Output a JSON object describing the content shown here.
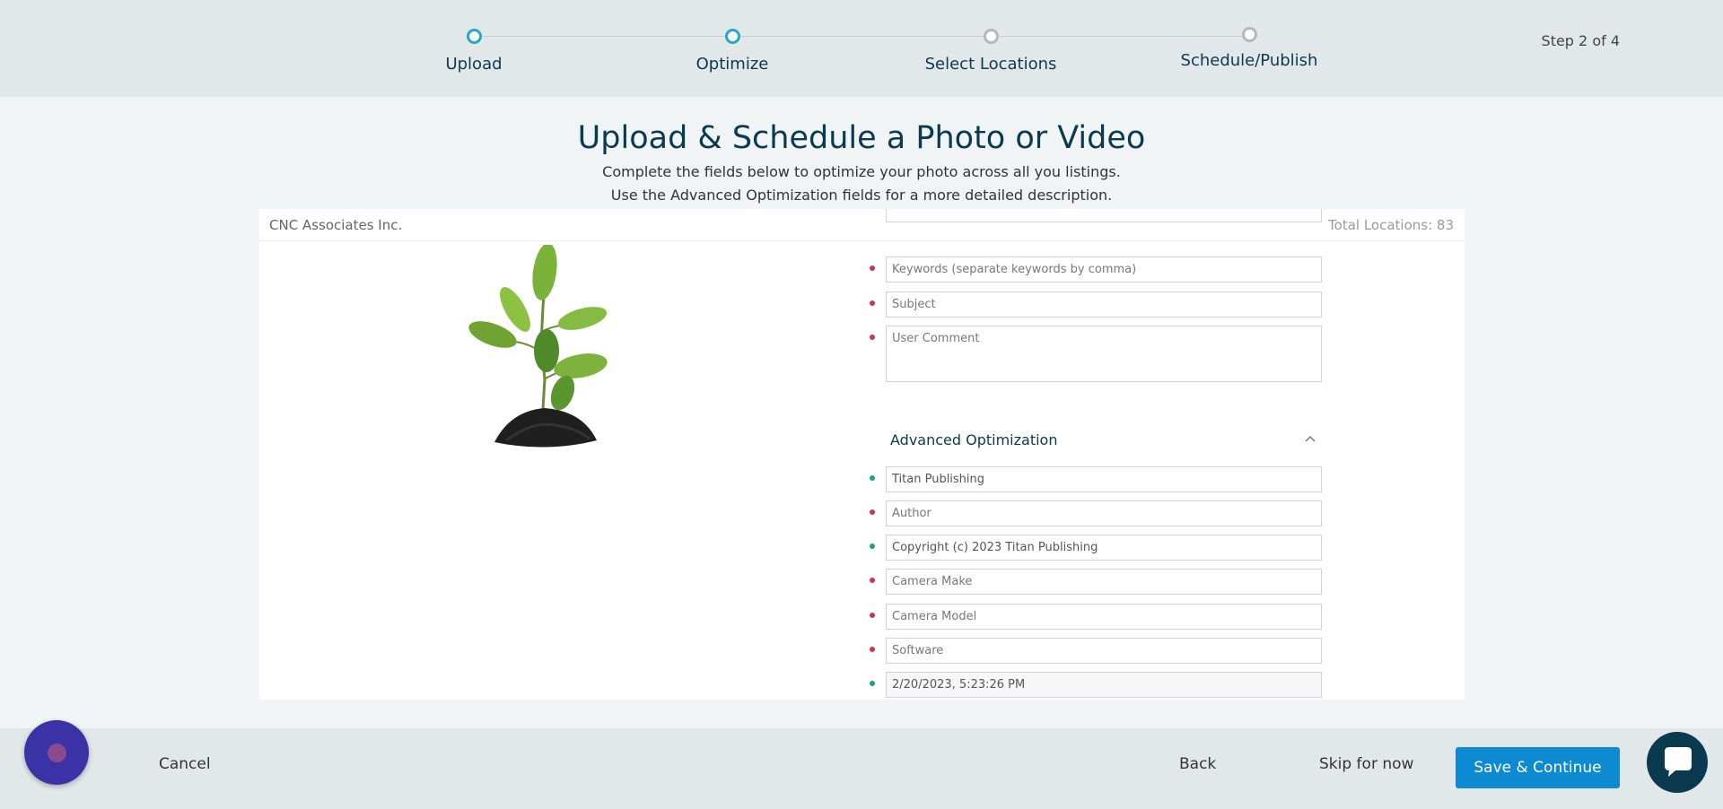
{
  "stepper": {
    "steps": [
      {
        "label": "Upload",
        "state": "done"
      },
      {
        "label": "Optimize",
        "state": "current"
      },
      {
        "label": "Select Locations",
        "state": "pending"
      },
      {
        "label": "Schedule/Publish",
        "state": "pending"
      }
    ],
    "step_count": "Step 2 of 4"
  },
  "page": {
    "title": "Upload & Schedule a Photo or Video",
    "subtitle_line1": "Complete the fields below to optimize your photo across all you listings.",
    "subtitle_line2": "Use the Advanced Optimization fields for a more detailed description."
  },
  "card": {
    "org_name": "CNC Associates Inc.",
    "total_locations": "Total Locations: 83"
  },
  "fields": {
    "keywords_placeholder": "Keywords (separate keywords by comma)",
    "subject_placeholder": "Subject",
    "user_comment_placeholder": "User Comment"
  },
  "advanced": {
    "title": "Advanced Optimization",
    "publisher_value": "Titan Publishing",
    "author_placeholder": "Author",
    "copyright_value": "Copyright (c) 2023 Titan Publishing",
    "camera_make_placeholder": "Camera Make",
    "camera_model_placeholder": "Camera Model",
    "software_placeholder": "Software",
    "datetime_value": "2/20/2023, 5:23:26 PM"
  },
  "footer": {
    "cancel_label": "Cancel",
    "back_label": "Back",
    "skip_label": "Skip for now",
    "save_label": "Save & Continue"
  },
  "colors": {
    "accent": "#21a9c9",
    "primary_button": "#0d8ad1",
    "required_dot": "#d0334d",
    "valid_dot": "#1aa37a"
  },
  "icons": {
    "collapse": "chevron-up-icon",
    "chat": "chat-bubble-icon"
  }
}
